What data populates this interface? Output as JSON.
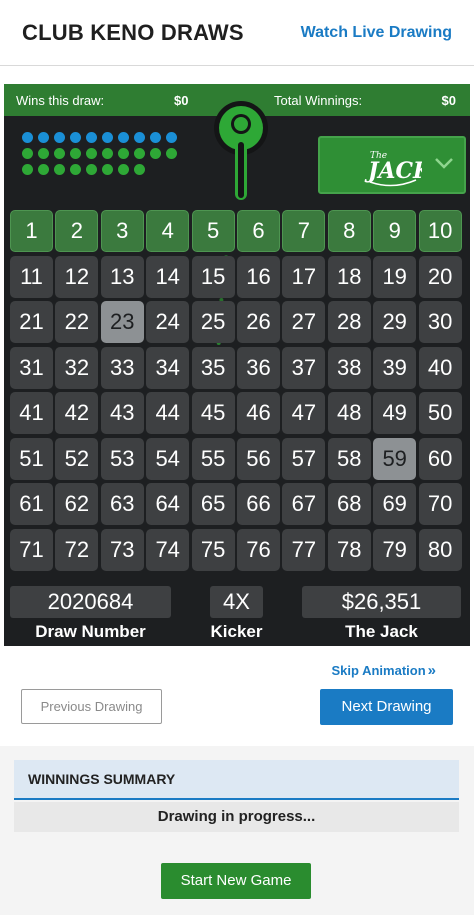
{
  "header": {
    "title": "CLUB KENO DRAWS",
    "watch_live": "Watch Live Drawing"
  },
  "winbar": {
    "wins_label": "Wins this draw:",
    "wins_value": "$0",
    "total_label": "Total Winnings:",
    "total_value": "$0"
  },
  "jack_selector": {
    "logo_text": "The JACK",
    "icon": "chevron-down-icon"
  },
  "grid": {
    "numbers": [
      1,
      2,
      3,
      4,
      5,
      6,
      7,
      8,
      9,
      10,
      11,
      12,
      13,
      14,
      15,
      16,
      17,
      18,
      19,
      20,
      21,
      22,
      23,
      24,
      25,
      26,
      27,
      28,
      29,
      30,
      31,
      32,
      33,
      34,
      35,
      36,
      37,
      38,
      39,
      40,
      41,
      42,
      43,
      44,
      45,
      46,
      47,
      48,
      49,
      50,
      51,
      52,
      53,
      54,
      55,
      56,
      57,
      58,
      59,
      60,
      61,
      62,
      63,
      64,
      65,
      66,
      67,
      68,
      69,
      70,
      71,
      72,
      73,
      74,
      75,
      76,
      77,
      78,
      79,
      80
    ],
    "highlighted": [
      23,
      59
    ],
    "colors": {
      "cell": "#3e4042",
      "top_row": "#3b7a3e",
      "hit": "#8d9194",
      "ball_blue": "#1a8fd6",
      "ball_green": "#2ea836"
    }
  },
  "stats": {
    "draw_number": "2020684",
    "draw_number_label": "Draw Number",
    "kicker": "4X",
    "kicker_label": "Kicker",
    "jack": "$26,351",
    "jack_label": "The Jack"
  },
  "controls": {
    "skip_animation": "Skip Animation",
    "previous": "Previous Drawing",
    "next": "Next Drawing"
  },
  "summary": {
    "heading": "WINNINGS SUMMARY",
    "status": "Drawing in progress...",
    "start_new": "Start New Game"
  }
}
